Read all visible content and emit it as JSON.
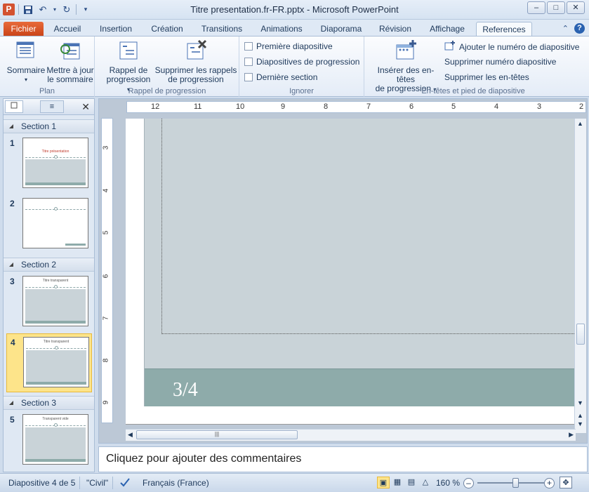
{
  "window": {
    "title": "Titre presentation.fr-FR.pptx - Microsoft PowerPoint",
    "app_icon_letter": "P"
  },
  "tabs": [
    {
      "label": "Fichier"
    },
    {
      "label": "Accueil"
    },
    {
      "label": "Insertion"
    },
    {
      "label": "Création"
    },
    {
      "label": "Transitions"
    },
    {
      "label": "Animations"
    },
    {
      "label": "Diaporama"
    },
    {
      "label": "Révision"
    },
    {
      "label": "Affichage"
    },
    {
      "label": "References"
    }
  ],
  "ribbon": {
    "plan": {
      "label": "Plan",
      "sommaire": "Sommaire",
      "mettre_line1": "Mettre à jour",
      "mettre_line2": "le sommaire"
    },
    "rappel": {
      "label": "Rappel de progression",
      "rappel_line1": "Rappel de",
      "rappel_line2": "progression",
      "supprimer_line1": "Supprimer les rappels",
      "supprimer_line2": "de progression"
    },
    "ignorer": {
      "label": "Ignorer",
      "items": [
        "Première diapositive",
        "Diapositives de progression",
        "Dernière section"
      ]
    },
    "entetes": {
      "label": "En-têtes et pied de diapositive",
      "inserer_line1": "Insérer des en-têtes",
      "inserer_line2": "de progression",
      "ajouter": "Ajouter le numéro de diapositive",
      "supprimer_numero": "Supprimer numéro diapositive",
      "supprimer_entetes": "Supprimer les en-têtes"
    }
  },
  "slides_panel": {
    "sections": [
      "Section 1",
      "Section 2",
      "Section 3"
    ],
    "slides": [
      {
        "num": "1",
        "thumb_text": "Titre présentation"
      },
      {
        "num": "2",
        "thumb_text": ""
      },
      {
        "num": "3",
        "thumb_text": "Titre transparent"
      },
      {
        "num": "4",
        "thumb_text": "Titre transparent"
      },
      {
        "num": "5",
        "thumb_text": "Transparent vide"
      }
    ],
    "selected_slide": 4
  },
  "ruler": {
    "horizontal": [
      "12",
      "11",
      "10",
      "9",
      "8",
      "7",
      "6",
      "5",
      "4",
      "3",
      "2"
    ],
    "vertical": [
      "3",
      "4",
      "5",
      "6",
      "7",
      "8",
      "9"
    ]
  },
  "slide": {
    "number_text": "3/4",
    "band_color": "#8eabaa",
    "background_color": "#c9d3d8"
  },
  "notes": {
    "placeholder": "Cliquez pour ajouter des commentaires"
  },
  "statusbar": {
    "slide_info": "Diapositive 4 de 5",
    "theme": "\"Civil\"",
    "language": "Français (France)",
    "zoom": "160 %"
  }
}
